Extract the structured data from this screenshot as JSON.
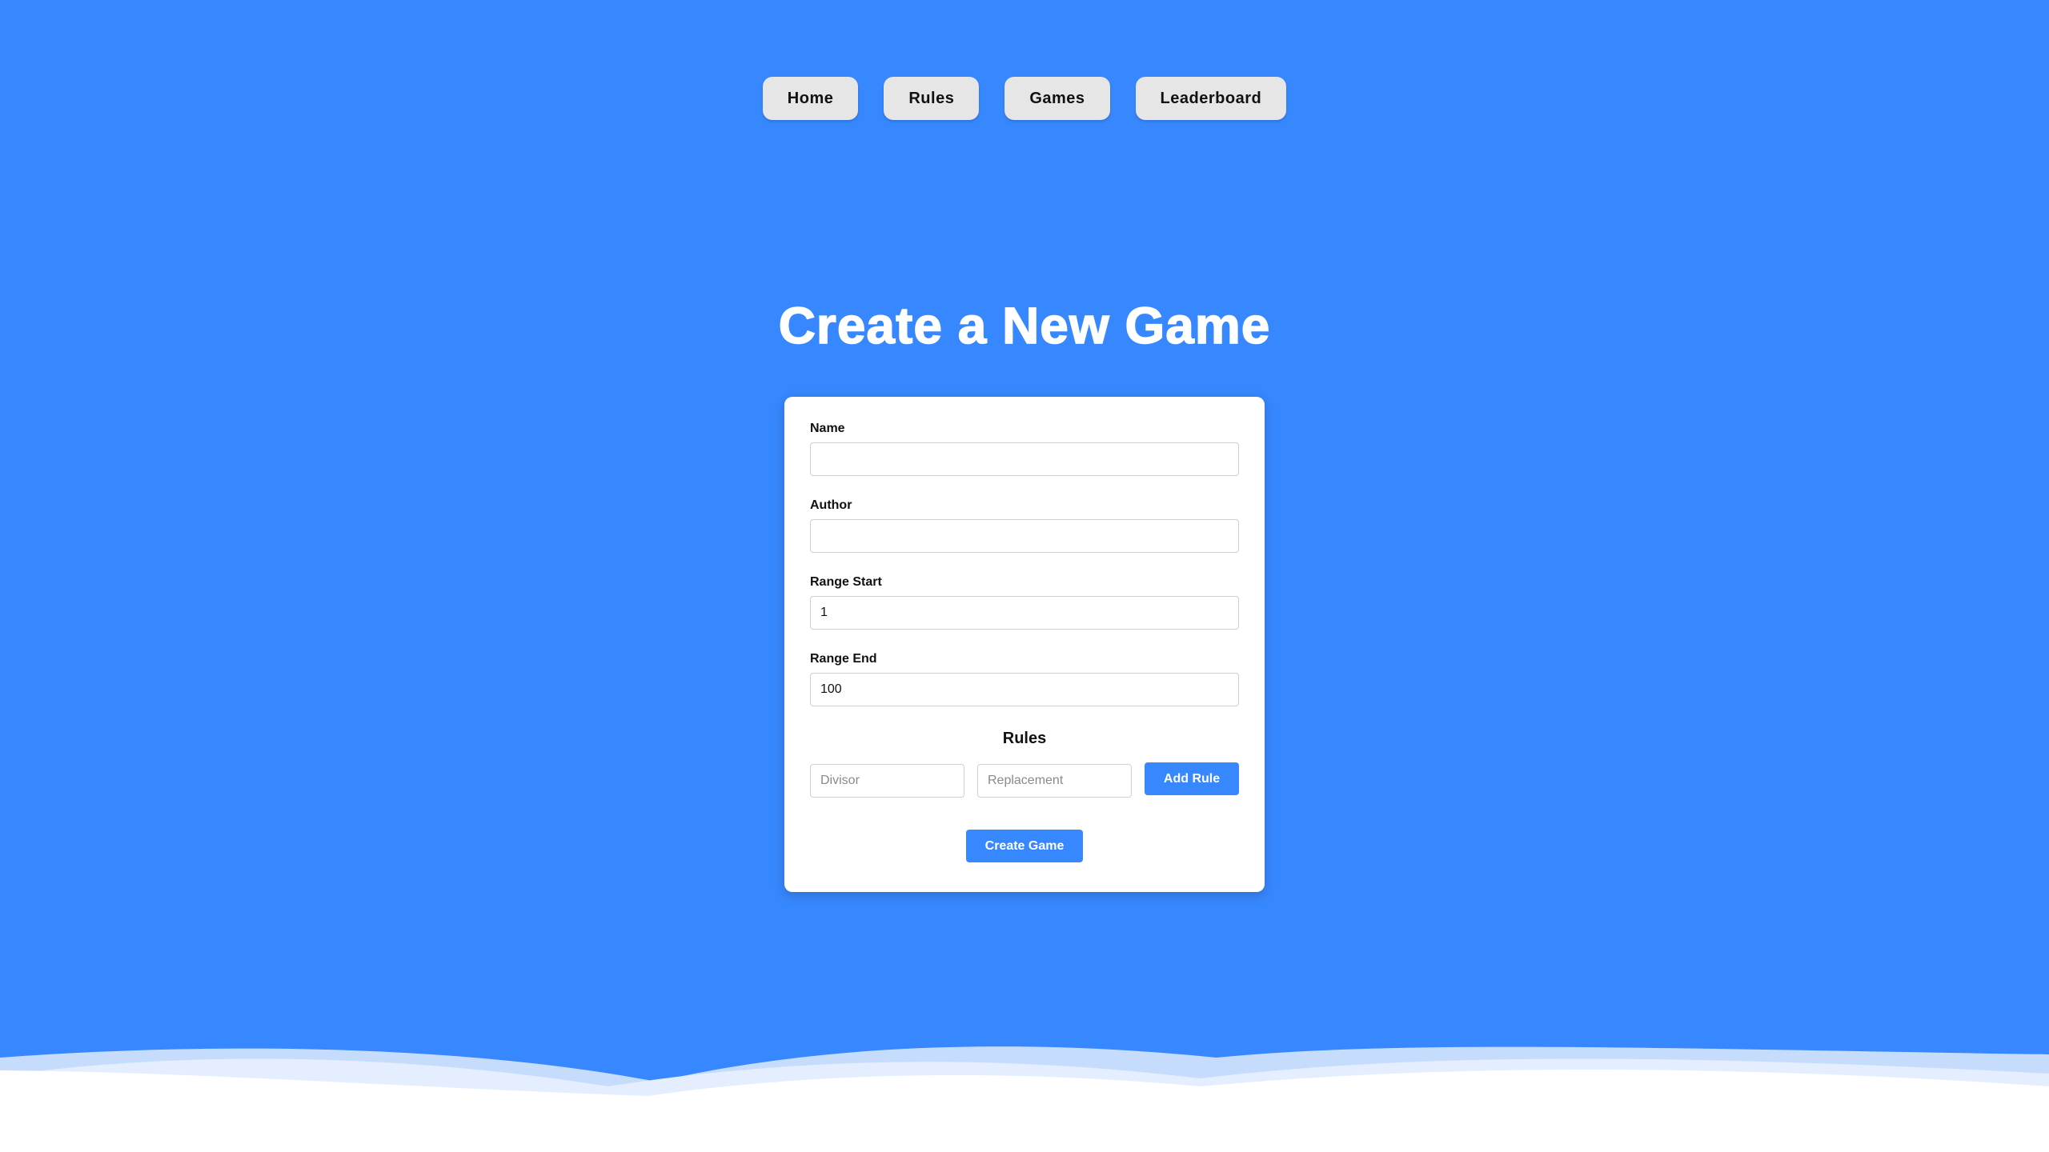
{
  "nav": {
    "home": "Home",
    "rules": "Rules",
    "games": "Games",
    "leaderboard": "Leaderboard"
  },
  "page_title": "Create a New Game",
  "form": {
    "name": {
      "label": "Name",
      "value": ""
    },
    "author": {
      "label": "Author",
      "value": ""
    },
    "range_start": {
      "label": "Range Start",
      "value": "1"
    },
    "range_end": {
      "label": "Range End",
      "value": "100"
    },
    "rules_heading": "Rules",
    "divisor_placeholder": "Divisor",
    "replacement_placeholder": "Replacement",
    "add_rule_label": "Add Rule",
    "create_label": "Create Game"
  },
  "colors": {
    "background": "#3787fe",
    "accent": "#3787fe",
    "card": "#ffffff",
    "nav_button": "#e6e6e6"
  }
}
